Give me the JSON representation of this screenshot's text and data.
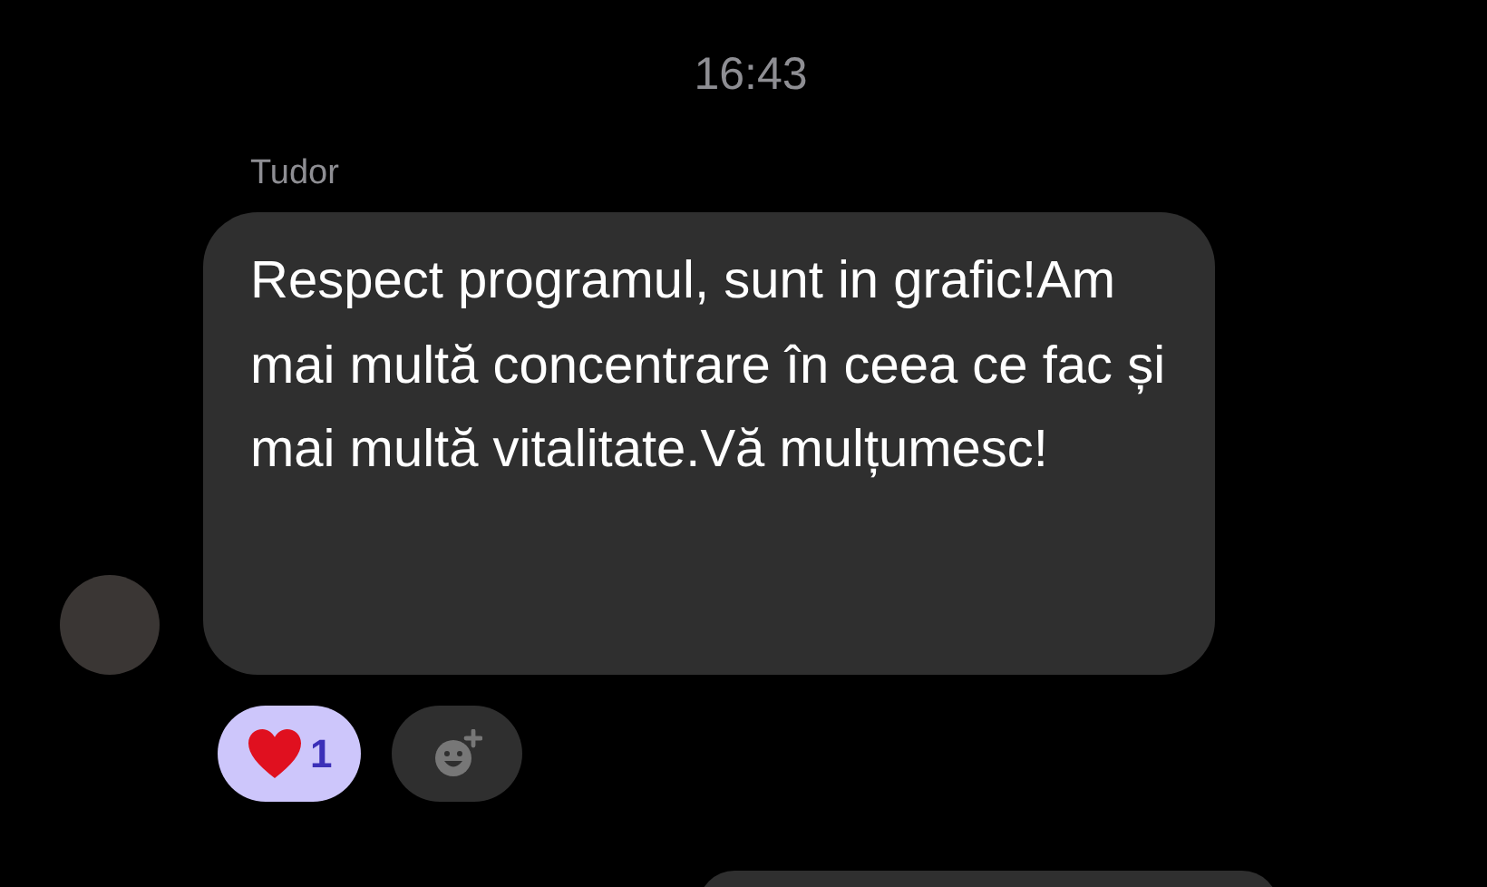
{
  "timestamp": "16:43",
  "message": {
    "sender": "Tudor",
    "text": "Respect programul, sunt in grafic!Am mai multă concentrare în ceea ce fac și mai multă vitalitate.Vă mulțumesc!"
  },
  "reactions": [
    {
      "kind": "heart",
      "count": "1",
      "selected": true
    }
  ]
}
